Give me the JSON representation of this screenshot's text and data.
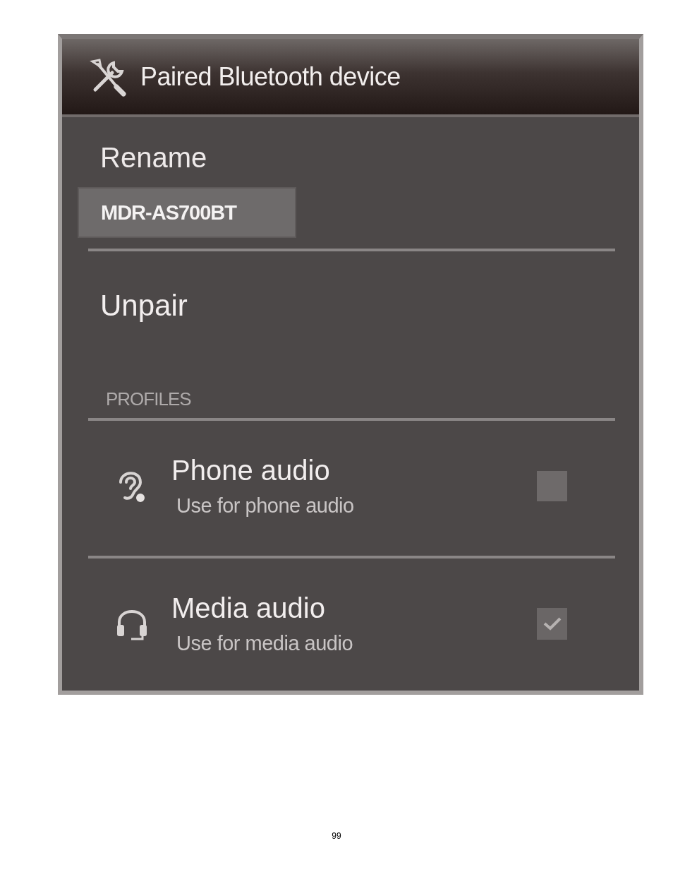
{
  "dialog": {
    "title": "Paired Bluetooth device",
    "rename": {
      "label": "Rename",
      "value": "MDR-AS700BT"
    },
    "unpair": {
      "label": "Unpair"
    },
    "profiles": {
      "heading": "PROFILES",
      "items": [
        {
          "kind": "phone",
          "title": "Phone audio",
          "subtitle": "Use for phone audio",
          "checked": false
        },
        {
          "kind": "media",
          "title": "Media audio",
          "subtitle": "Use for media audio",
          "checked": true
        }
      ]
    }
  },
  "page_number": "99"
}
